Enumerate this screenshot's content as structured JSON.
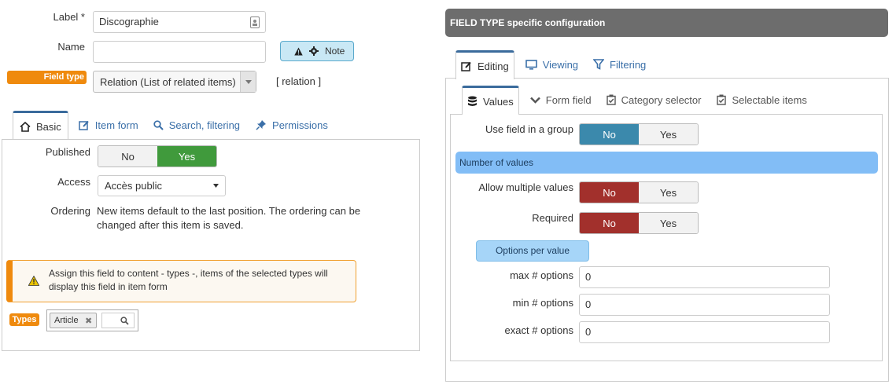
{
  "left": {
    "label_field": {
      "label": "Label *",
      "value": "Discographie"
    },
    "name_field": {
      "label": "Name",
      "value": ""
    },
    "note_button": "Note",
    "field_type": {
      "badge": "Field type",
      "selected": "Relation (List of related items)",
      "type_code": "[ relation ]"
    },
    "tabs": [
      {
        "label": "Basic",
        "icon": "home-icon"
      },
      {
        "label": "Item form",
        "icon": "edit-icon"
      },
      {
        "label": "Search, filtering",
        "icon": "search-icon"
      },
      {
        "label": "Permissions",
        "icon": "pushpin-icon"
      }
    ],
    "published": {
      "label": "Published",
      "no": "No",
      "yes": "Yes",
      "value": "Yes"
    },
    "access": {
      "label": "Access",
      "selected": "Accès public"
    },
    "ordering": {
      "label": "Ordering",
      "text": "New items default to the last position. The ordering can be changed after this item is saved."
    },
    "warning": "Assign this field to content - types -, items of the selected types will display this field in item form",
    "types": {
      "badge": "Types",
      "chip": "Article"
    }
  },
  "right": {
    "header": "FIELD TYPE specific configuration",
    "tabs": [
      {
        "label": "Editing",
        "icon": "edit-icon"
      },
      {
        "label": "Viewing",
        "icon": "monitor-icon"
      },
      {
        "label": "Filtering",
        "icon": "filter-icon"
      }
    ],
    "subtabs": [
      {
        "label": "Values",
        "icon": "database-icon"
      },
      {
        "label": "Form field",
        "icon": "chevron-down-icon"
      },
      {
        "label": "Category selector",
        "icon": "checkbox-icon"
      },
      {
        "label": "Selectable items",
        "icon": "checkbox-icon"
      }
    ],
    "use_group": {
      "label": "Use field in a group",
      "no": "No",
      "yes": "Yes",
      "value": "No"
    },
    "number_of_values": "Number of values",
    "allow_multiple": {
      "label": "Allow multiple values",
      "no": "No",
      "yes": "Yes",
      "value": "No"
    },
    "required": {
      "label": "Required",
      "no": "No",
      "yes": "Yes",
      "value": "No"
    },
    "options_per_value": "Options per value",
    "max_options": {
      "label": "max # options",
      "value": "0"
    },
    "min_options": {
      "label": "min # options",
      "value": "0"
    },
    "exact_options": {
      "label": "exact # options",
      "value": "0"
    }
  },
  "colors": {
    "accent_orange": "#ef8a0e",
    "green_yes": "#409a3c",
    "red_no": "#a2302c",
    "blue_no": "#3b89ac",
    "tab_link": "#3a6fa8",
    "header_grey": "#6d6d6d",
    "section_blue": "#82bdf6"
  }
}
